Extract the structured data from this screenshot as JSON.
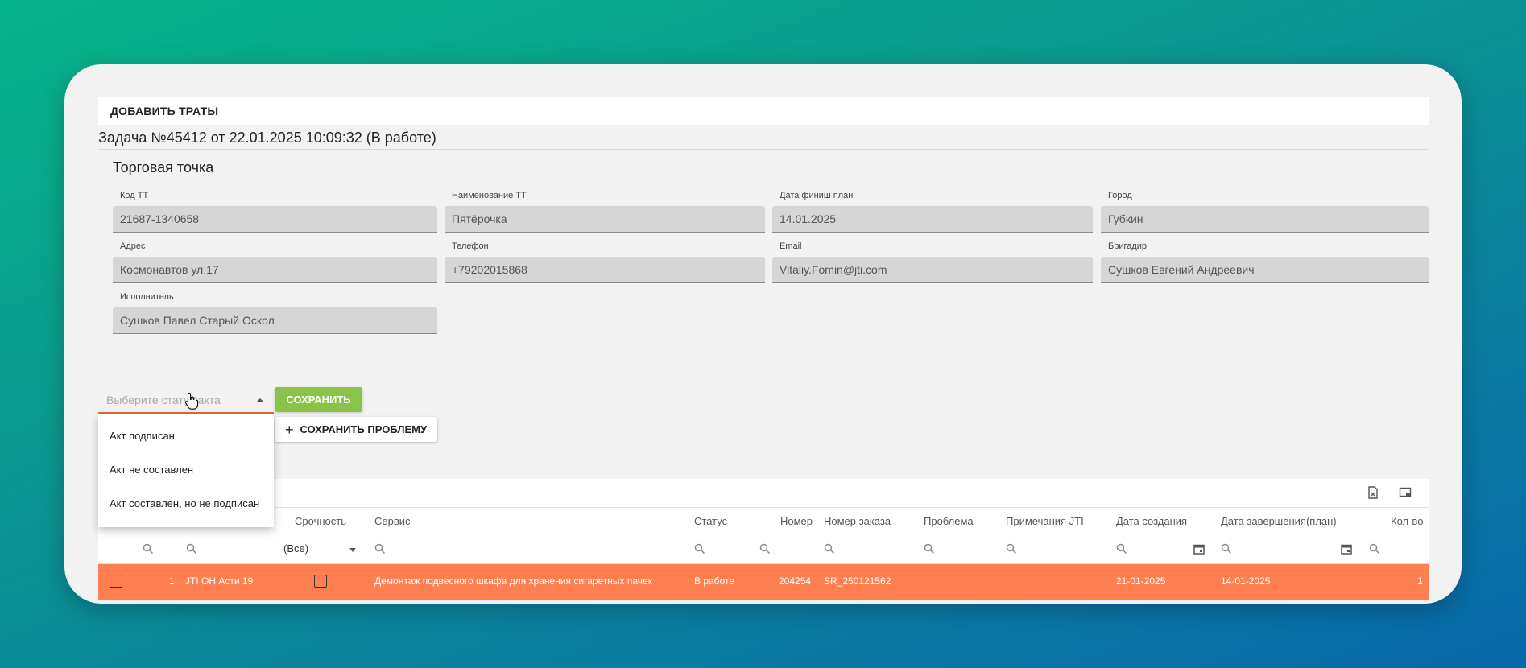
{
  "toolbar": {
    "add_expenses": "ДОБАВИТЬ ТРАТЫ"
  },
  "task": {
    "title": "Задача №45412 от 22.01.2025 10:09:32 (В работе)"
  },
  "section": {
    "title": "Торговая точка"
  },
  "fields": [
    {
      "label": "Код ТТ",
      "value": "21687-1340658"
    },
    {
      "label": "Наименование ТТ",
      "value": "Пятёрочка"
    },
    {
      "label": "Дата финиш план",
      "value": "14.01.2025"
    },
    {
      "label": "Город",
      "value": "Губкин"
    },
    {
      "label": "Адрес",
      "value": "Космонавтов ул.17"
    },
    {
      "label": "Телефон",
      "value": "+79202015868"
    },
    {
      "label": "Email",
      "value": "Vitaliy.Fomin@jti.com"
    },
    {
      "label": "Бригадир",
      "value": "Сушков Евгений Андреевич"
    },
    {
      "label": "Исполнитель",
      "value": "Сушков Павел Старый Оскол"
    }
  ],
  "act_select": {
    "placeholder": "Выберите статус акта",
    "options": [
      "Акт подписан",
      "Акт не составлен",
      "Акт составлен, но не подписан"
    ]
  },
  "buttons": {
    "save": "СОХРАНИТЬ",
    "save_problem": "СОХРАНИТЬ ПРОБЛЕМУ"
  },
  "grid": {
    "columns": [
      "Срочность",
      "Сервис",
      "Статус",
      "Номер",
      "Номер заказа",
      "Проблема",
      "Примечания JTI",
      "Дата создания",
      "Дата завершения(план)",
      "Кол-во"
    ],
    "filter_urgency": "(Все)",
    "row": {
      "index": "1",
      "name": "JTI ОН Асти 19",
      "service": "Демонтаж подвесного шкафа для хранения сигаретных пачек",
      "status": "В работе",
      "number": "204254",
      "order": "SR_250121562",
      "created": "21-01-2025",
      "due": "14-01-2025",
      "qty": "1"
    }
  },
  "colors": {
    "accent_green": "#8bc34a",
    "row_highlight": "#ff7f50",
    "select_underline": "#d96c3b"
  }
}
